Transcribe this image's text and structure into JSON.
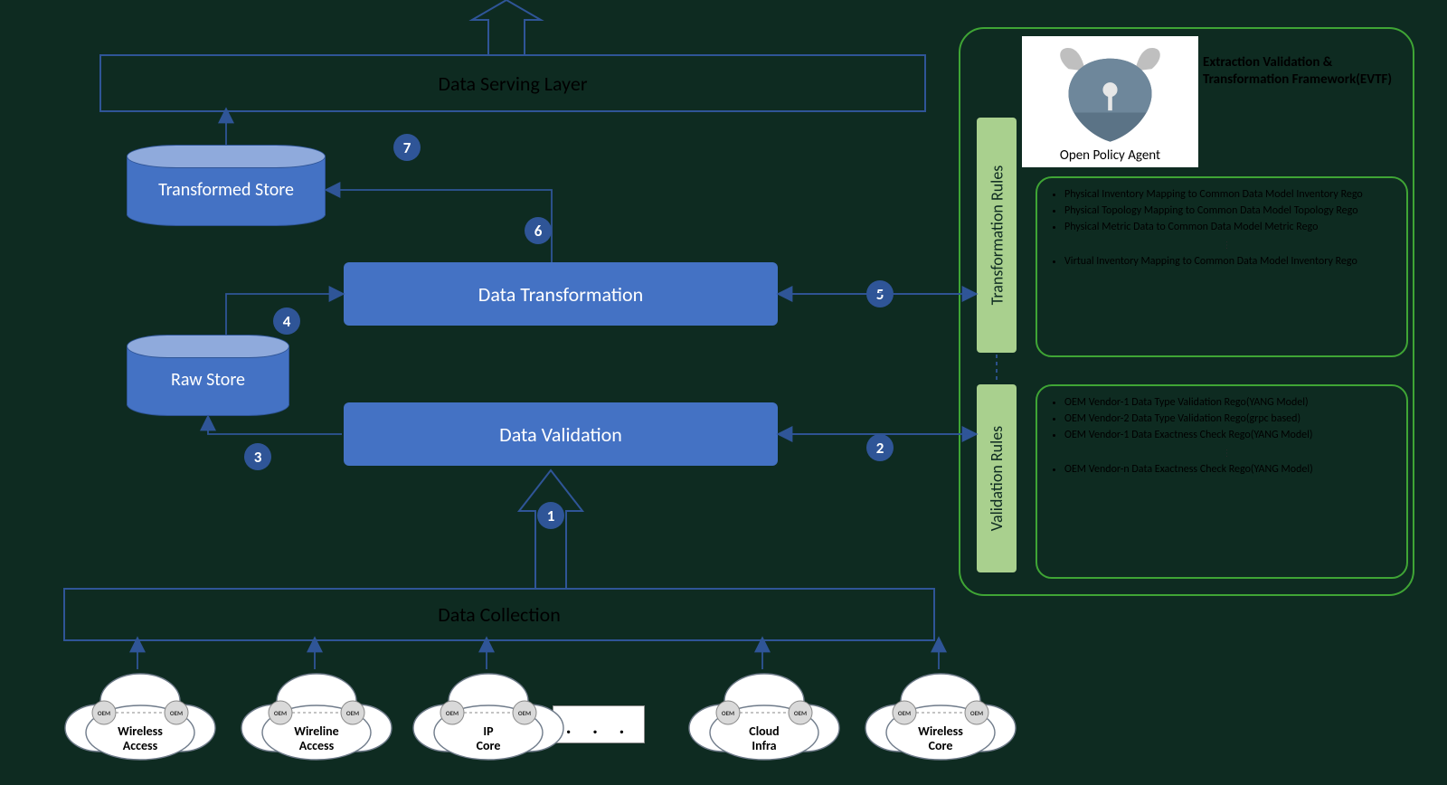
{
  "layers": {
    "serving": "Data Serving Layer",
    "collection": "Data Collection"
  },
  "processes": {
    "validation": "Data Validation",
    "transformation": "Data Transformation"
  },
  "stores": {
    "raw": "Raw Store",
    "transformed": "Transformed Store"
  },
  "steps": {
    "s1": "1",
    "s2": "2",
    "s3": "3",
    "s4": "4",
    "s5": "5",
    "s6": "6",
    "s7": "7"
  },
  "evtf": {
    "title": "Extraction Validation & Transformation Framework(EVTF)",
    "opa_label": "Open Policy Agent",
    "transformation_rules_label": "Transformation Rules",
    "validation_rules_label": "Validation Rules",
    "transformation_rules": [
      "Physical Inventory Mapping to Common Data Model Inventory Rego",
      "Physical Topology Mapping to Common Data Model Topology Rego",
      "Physical Metric Data to Common Data Model Metric Rego"
    ],
    "transformation_rules_last": "Virtual Inventory Mapping to Common Data Model Inventory Rego",
    "validation_rules": [
      "OEM Vendor-1 Data Type Validation Rego(YANG Model)",
      "OEM Vendor-2 Data Type Validation Rego(grpc based)",
      "OEM Vendor-1 Data Exactness Check Rego(YANG Model)"
    ],
    "validation_rules_last": "OEM Vendor-n Data Exactness Check Rego(YANG Model)"
  },
  "clouds": {
    "c1": "Wireless Access",
    "c2": "Wireline Access",
    "c3": "IP Core",
    "c4": "Cloud Infra",
    "c5": "Wireless Core",
    "oem": "OEM",
    "ellipsis": ". . ."
  }
}
